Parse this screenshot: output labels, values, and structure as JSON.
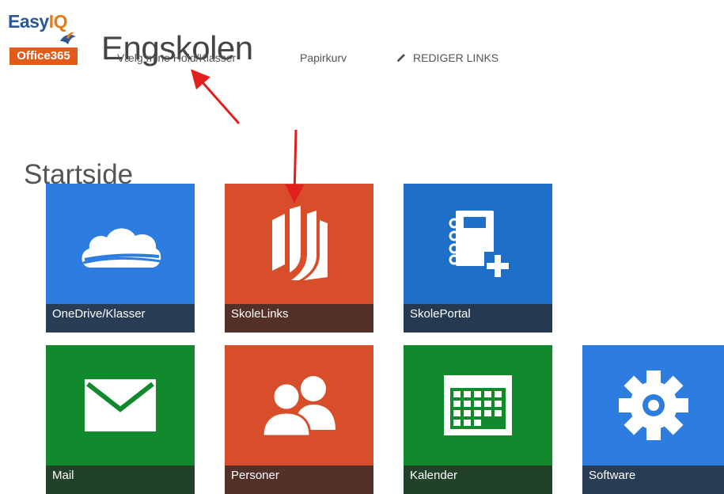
{
  "logo": {
    "easy": "Easy",
    "iq": "IQ",
    "office": "Office365",
    "colors": {
      "blue": "#2b5797",
      "orange": "#e25b1a"
    }
  },
  "site": {
    "title": "Engskolen"
  },
  "nav": {
    "items": [
      {
        "label": "Vælg mine Hold/Klasser"
      },
      {
        "label": "Papirkurv"
      },
      {
        "label": "REDIGER LINKS",
        "icon": "pencil-icon"
      }
    ]
  },
  "page": {
    "heading": "Startside"
  },
  "tiles": [
    {
      "label": "OneDrive/Klasser",
      "icon": "cloud-icon",
      "color": "#2d7de0"
    },
    {
      "label": "SkoleLinks",
      "icon": "book-icon",
      "color": "#d84e2a"
    },
    {
      "label": "SkolePortal",
      "icon": "notebook-add-icon",
      "color": "#1e6fc7"
    },
    {
      "label": "Mail",
      "icon": "mail-icon",
      "color": "#118a2e"
    },
    {
      "label": "Personer",
      "icon": "people-icon",
      "color": "#d84e2a"
    },
    {
      "label": "Kalender",
      "icon": "calendar-icon",
      "color": "#118a2e"
    },
    {
      "label": "Software",
      "icon": "gear-icon",
      "color": "#2d7de0"
    }
  ],
  "annotations": {
    "arrow_color": "#e0201f"
  }
}
